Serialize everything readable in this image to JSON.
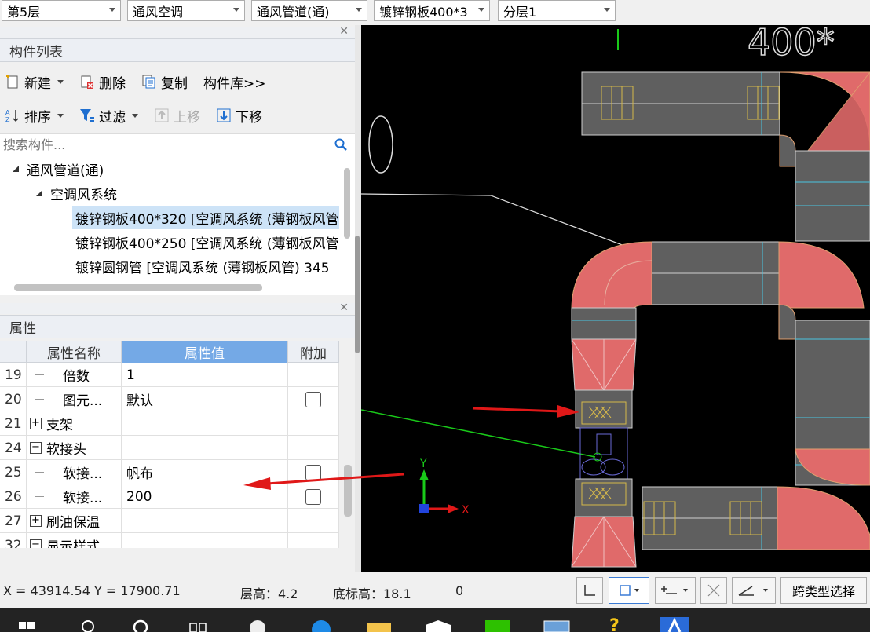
{
  "top_selectors": [
    {
      "value": "第5层"
    },
    {
      "value": "通风空调"
    },
    {
      "value": "通风管道(通)"
    },
    {
      "value": "镀锌钢板400*3"
    },
    {
      "value": "分层1"
    }
  ],
  "component_list": {
    "title": "构件列表",
    "toolbar1": {
      "new": "新建",
      "delete": "删除",
      "copy": "复制",
      "library": "构件库>>"
    },
    "toolbar2": {
      "sort": "排序",
      "filter": "过滤",
      "move_up": "上移",
      "move_down": "下移"
    },
    "search_placeholder": "搜索构件...",
    "tree": [
      {
        "label": "通风管道(通)",
        "level": 0
      },
      {
        "label": "空调风系统",
        "level": 1
      },
      {
        "label": "镀锌钢板400*320 [空调风系统 (薄钢板风管",
        "level": 2,
        "selected": true
      },
      {
        "label": "镀锌钢板400*250 [空调风系统 (薄钢板风管",
        "level": 2
      },
      {
        "label": "镀锌圆钢管 [空调风系统 (薄钢板风管) 345",
        "level": 2
      }
    ]
  },
  "properties": {
    "title": "属性",
    "columns": {
      "name": "属性名称",
      "value": "属性值",
      "extra": "附加"
    },
    "rows": [
      {
        "num": "19",
        "name": "倍数",
        "value": "1",
        "indent": true,
        "checkbox": false
      },
      {
        "num": "20",
        "name": "图元...",
        "value": "默认",
        "indent": true,
        "checkbox": true
      },
      {
        "num": "21",
        "name": "支架",
        "value": "",
        "expand": "+",
        "checkbox": false
      },
      {
        "num": "24",
        "name": "软接头",
        "value": "",
        "expand": "-",
        "checkbox": false
      },
      {
        "num": "25",
        "name": "软接...",
        "value": "帆布",
        "indent": true,
        "checkbox": true
      },
      {
        "num": "26",
        "name": "软接...",
        "value": "200",
        "indent": true,
        "checkbox": true
      },
      {
        "num": "27",
        "name": "刷油保温",
        "value": "",
        "expand": "+",
        "checkbox": false
      },
      {
        "num": "32",
        "name": "显示样式",
        "value": "",
        "expand": "-",
        "checkbox": false
      }
    ]
  },
  "canvas": {
    "top_label": "400*",
    "axis_x": "X",
    "axis_y": "Y"
  },
  "statusbar": {
    "coords": "X = 43914.54 Y = 17900.71",
    "floor_height": "层高：4.2",
    "base_elev": "底标高：18.1",
    "zero": "0",
    "cross_select": "跨类型选择"
  }
}
